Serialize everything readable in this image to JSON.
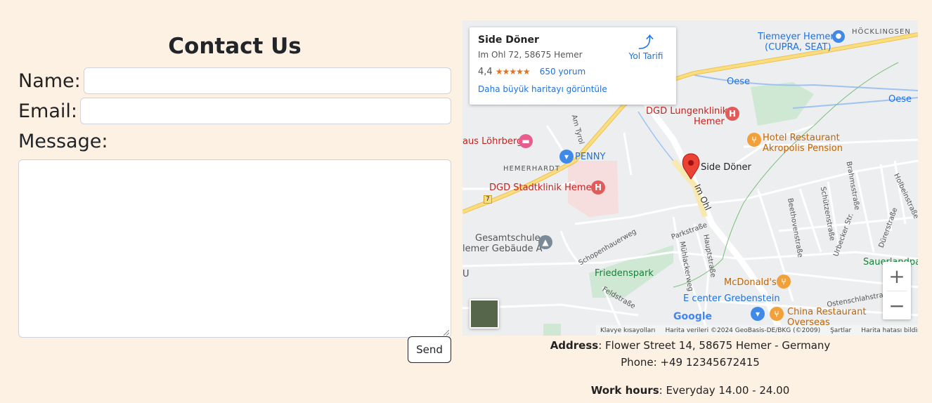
{
  "contact": {
    "title": "Contact Us",
    "name_label": "Name:",
    "name_value": "",
    "email_label": "Email:",
    "email_value": "",
    "message_label": "Message:",
    "message_value": "",
    "send_label": "Send"
  },
  "map": {
    "place_name": "Side Döner",
    "place_address": "Im Ohl 72, 58675 Hemer",
    "rating": "4,4",
    "stars": "★★★★★",
    "reviews": "650 yorum",
    "bigger_map": "Daha büyük haritayı görüntüle",
    "directions": "Yol Tarifi",
    "labels": {
      "tiemeyer": "Tiemeyer Hemer",
      "tiemeyer2": "(CUPRA, SEAT)",
      "hocklingsen": "HÖCKLINGSEN",
      "oese1": "Oese",
      "oese2": "Oese",
      "lungenklinik": "DGD Lungenklinik",
      "lungenklinik2": "Hemer",
      "hotel": "Hotel Restaurant",
      "hotel2": "Akropolis Pension",
      "lohrberg": "aus Löhrberg",
      "penny": "PENNY",
      "hemerhardt": "HEMERHARDT",
      "side_doner": "Side Döner",
      "stadtklinik": "DGD Stadtklinik Hemer",
      "im_ohl": "Im Ohl",
      "gesamtschule": "Gesamtschule",
      "gesamtschule2": "lemer Gebäude A",
      "friedenspark": "Friedenspark",
      "mcdonalds": "McDonald's",
      "ecenter": "E center Grebenstein",
      "china": "China Restaurant",
      "china2": "Overseas",
      "sauerland": "Sauerlandpa",
      "am_tyrol": "Am Tyrol",
      "schopenhauerweg": "Schopenhauerweg",
      "parkstrasse": "Parkstraße",
      "hauptstrasse": "Hauptstraße",
      "muhlackerweg": "Mühlackerweg",
      "feldstrasse": "Feldstraße",
      "beethovenstrasse": "Beethovenstraße",
      "schutzenstrasse": "Schützenstraße",
      "brahmsstrasse": "Brahmsstraße",
      "urbecker": "Urbecker Str.",
      "durerstrasse": "Dürerstraße",
      "holbeinstrasse": "Holbeinstraße",
      "ostenschlahstrasse": "Ostenschlahstraße",
      "road7": "7",
      "u": "U",
      "google": "Google"
    },
    "footer": {
      "shortcuts": "Klavye kısayolları",
      "map_data": "Harita verileri ©2024 GeoBasis-DE/BKG (©2009)",
      "terms": "Şartlar",
      "report": "Harita hatası bildirin"
    },
    "zoom_in": "+",
    "zoom_out": "−"
  },
  "info": {
    "address_label": "Address",
    "address_value": ": Flower Street 14, 58675 Hemer - Germany",
    "phone": "Phone: +49 12345672415",
    "hours_label": "Work hours",
    "hours_value": ": Everyday 14.00 - 24.00"
  },
  "colors": {
    "page_bg": "#fdf1e4",
    "link_blue": "#1a73e8",
    "marker_red": "#ea4335",
    "road_yellow": "#f7d36b"
  }
}
